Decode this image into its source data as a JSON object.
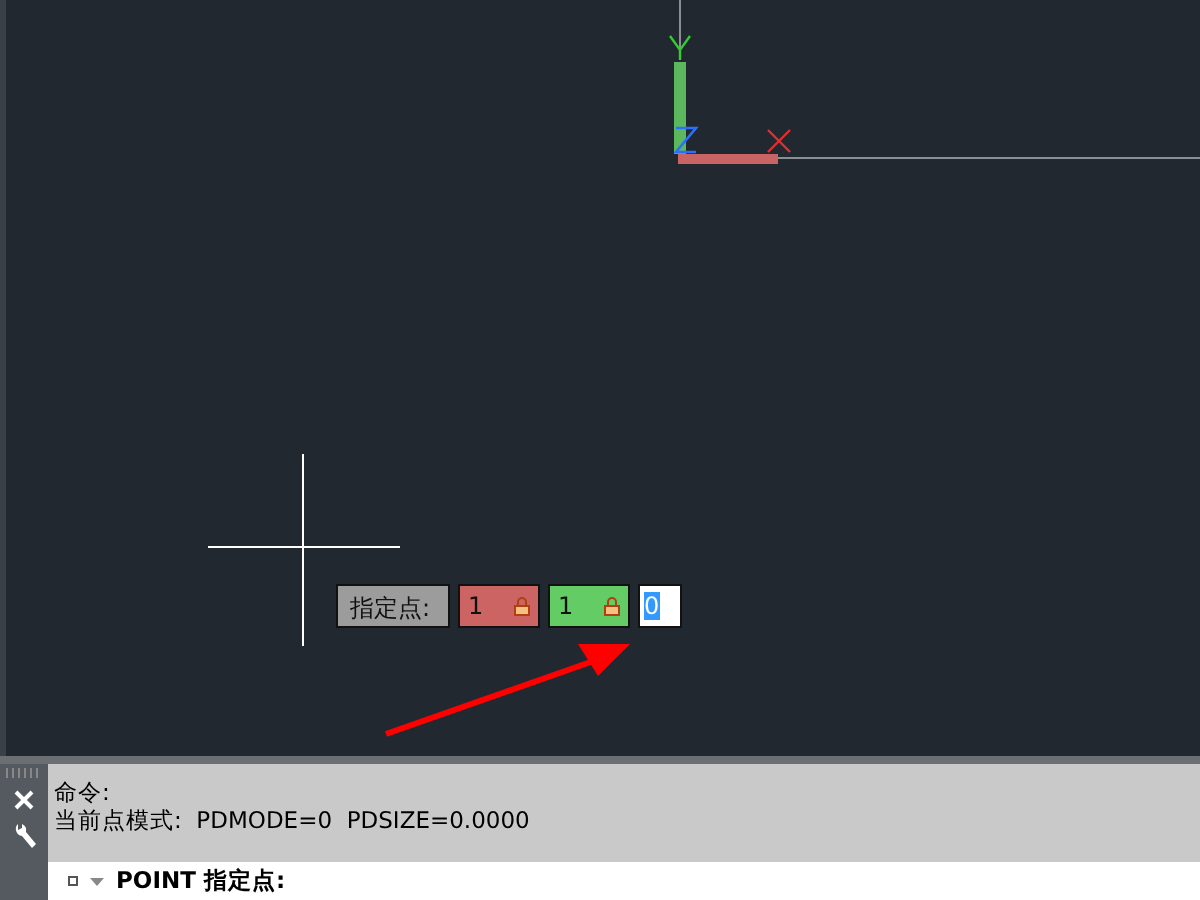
{
  "drawing_area": {
    "dynamic_input": {
      "prompt": "指定点:",
      "fields": [
        {
          "value": "1",
          "locked": true,
          "color": "#cd6464",
          "selected": false
        },
        {
          "value": "1",
          "locked": true,
          "color": "#64cc64",
          "selected": false
        },
        {
          "value": "0",
          "locked": false,
          "color": "#ffffff",
          "selected": true
        }
      ]
    }
  },
  "command_line": {
    "history": [
      "命令:",
      "当前点模式:  PDMODE=0  PDSIZE=0.0000"
    ],
    "command": "POINT",
    "prompt": "指定点:"
  }
}
